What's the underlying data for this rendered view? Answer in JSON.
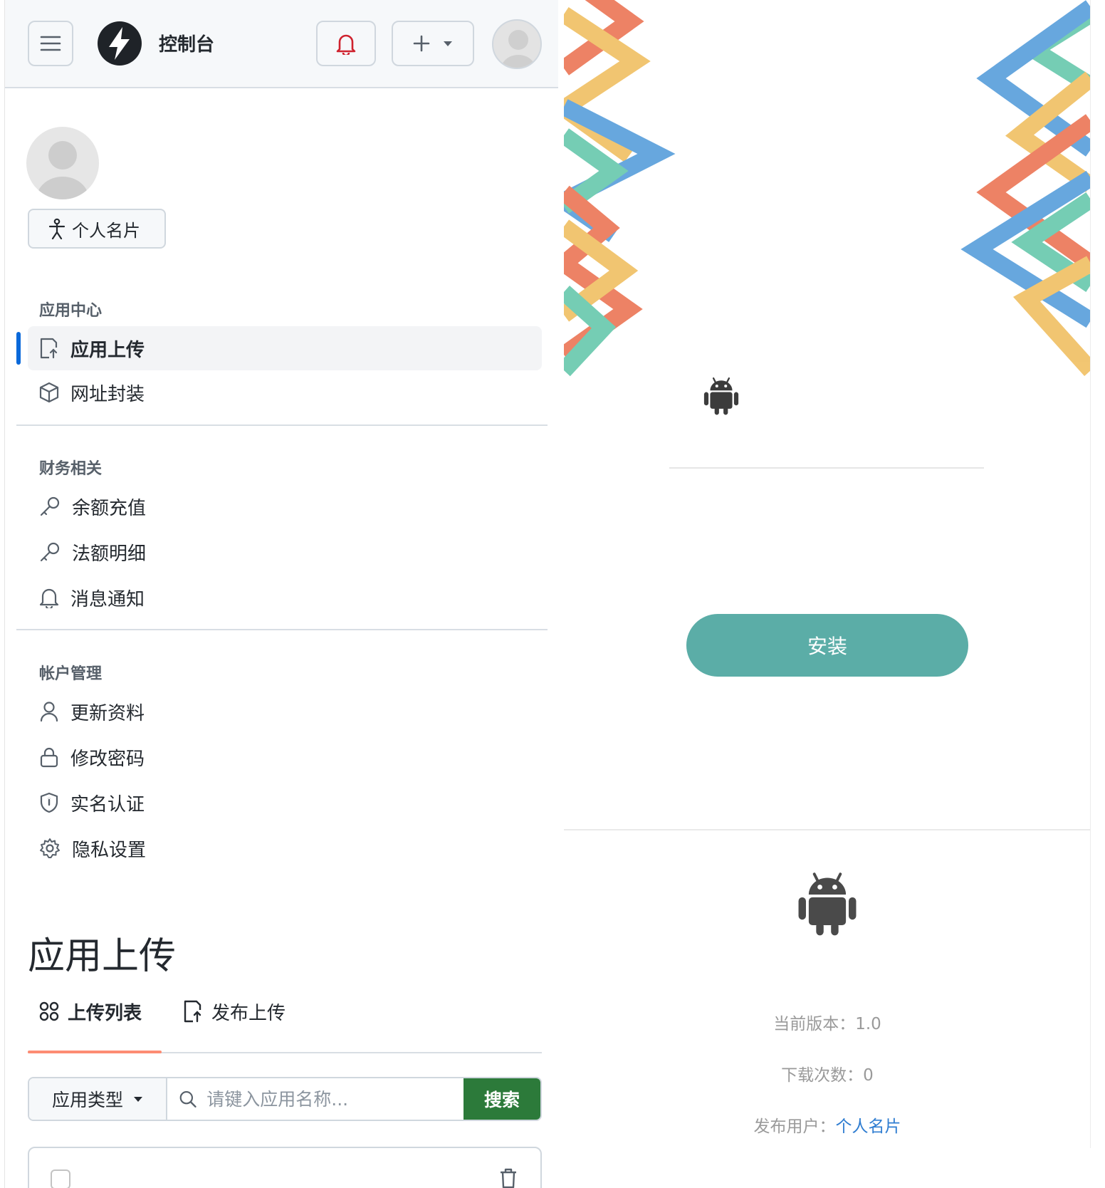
{
  "header": {
    "title": "控制台",
    "icons": [
      "hamburger-icon",
      "lightning-logo-icon",
      "bell-icon",
      "plus-icon",
      "caret-down-icon",
      "avatar-icon"
    ]
  },
  "profile": {
    "card_button": "个人名片"
  },
  "sidebar": {
    "sections": [
      {
        "title": "应用中心",
        "items": [
          {
            "label": "应用上传",
            "icon": "upload-icon",
            "active": true
          },
          {
            "label": "网址封装",
            "icon": "package-icon"
          }
        ]
      },
      {
        "title": "财务相关",
        "items": [
          {
            "label": "余额充值",
            "icon": "key-icon"
          },
          {
            "label": "法额明细",
            "icon": "key-icon"
          },
          {
            "label": "消息通知",
            "icon": "bell-icon"
          }
        ]
      },
      {
        "title": "帐户管理",
        "items": [
          {
            "label": "更新资料",
            "icon": "person-icon"
          },
          {
            "label": "修改密码",
            "icon": "lock-icon"
          },
          {
            "label": "实名认证",
            "icon": "shield-icon"
          },
          {
            "label": "隐私设置",
            "icon": "gear-icon"
          }
        ]
      }
    ]
  },
  "main": {
    "heading": "应用上传",
    "tabs": [
      {
        "label": "上传列表",
        "active": true
      },
      {
        "label": "发布上传",
        "active": false
      }
    ],
    "search": {
      "type_label": "应用类型",
      "placeholder": "请键入应用名称...",
      "submit": "搜索"
    }
  },
  "download": {
    "install_button": "安装",
    "info": {
      "version_label": "当前版本：",
      "version": "1.0",
      "downloads_label": "下载次数：",
      "downloads": "0",
      "publisher_label": "发布用户：",
      "publisher": "个人名片"
    }
  },
  "colors": {
    "active_nav_bar": "#0969da",
    "tab_underline": "#fd8c73",
    "search_button": "#2c7a3a",
    "install_button": "#5bada7",
    "link": "#2f7dd1",
    "ribbon_red": "#e8603a",
    "ribbon_yellow": "#eeb64a",
    "ribbon_blue": "#3d8fd6",
    "ribbon_green": "#4fbf9f"
  }
}
